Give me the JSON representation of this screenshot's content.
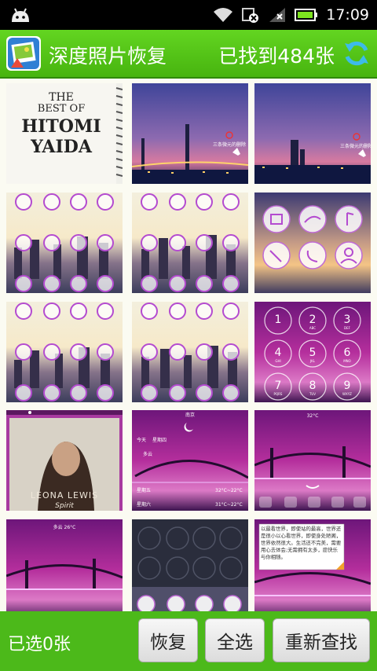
{
  "status_bar": {
    "time": "17:09",
    "icons": [
      "android-icon",
      "wifi-icon",
      "sync-icon",
      "signal-icon",
      "battery-icon"
    ]
  },
  "app_bar": {
    "title": "深度照片恢复",
    "found_text": "已找到484张",
    "icons": [
      "app-logo",
      "refresh-icon"
    ],
    "accent": "#4cb91a"
  },
  "thumbnails": {
    "album_cover": {
      "line1": "THE",
      "line2": "BEST OF",
      "line3": "HITOMI",
      "line4": "YAIDA"
    },
    "bridge_night": {
      "label": "三条微元的删除"
    },
    "lock_keys": [
      {
        "digit": "1",
        "letters": ""
      },
      {
        "digit": "2",
        "letters": "ABC"
      },
      {
        "digit": "3",
        "letters": "DEF"
      },
      {
        "digit": "4",
        "letters": "GHI"
      },
      {
        "digit": "5",
        "letters": "JKL"
      },
      {
        "digit": "6",
        "letters": "MNO"
      },
      {
        "digit": "7",
        "letters": "PQRS"
      },
      {
        "digit": "8",
        "letters": "TUV"
      },
      {
        "digit": "9",
        "letters": "WXYZ"
      }
    ],
    "leona": {
      "line1": "LEONA LEWIS",
      "line2": "Spirit"
    },
    "weather": {
      "title": "南京",
      "rows": [
        {
          "day": "今天",
          "date": "星期四",
          "temp": ""
        },
        {
          "day": "多云",
          "date": "",
          "temp": ""
        },
        {
          "day": "星期五",
          "date": "",
          "temp": "32°C~22°C"
        },
        {
          "day": "星期六",
          "date": "",
          "temp": "31°C~22°C"
        }
      ]
    },
    "temp_small_1": "32°C",
    "temp_small_2": "多云 26°C",
    "note": "以最看世界，即使站的最高，世界还是很小以心看世界，即使身处陋阁，世界依然很大。生活还不完美，需要用心去体会;无需拥有太多，愿快乐与你相随。"
  },
  "bottom_bar": {
    "selected_count": "已选0张",
    "buttons": {
      "recover": "恢复",
      "select_all": "全选",
      "rescan": "重新查找"
    }
  }
}
